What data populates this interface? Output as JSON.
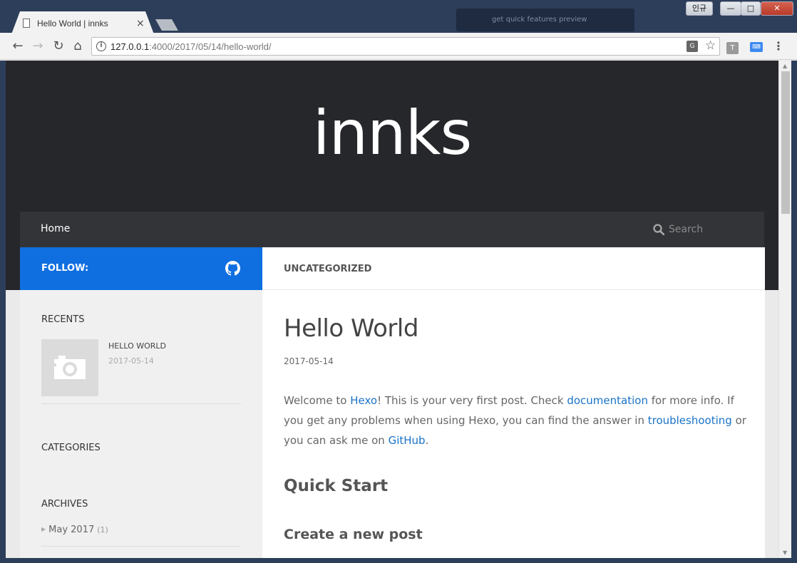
{
  "browser": {
    "tab_title": "Hello World | innks",
    "tab_close": "×",
    "url_host": "127.0.0.1",
    "url_rest": ":4000/2017/05/14/hello-world/",
    "user_button": "인규",
    "notification": "get quick features preview",
    "ext1_label": "T",
    "ext2_label": "⌨"
  },
  "site": {
    "title": "innks",
    "nav_home": "Home",
    "search_placeholder": "Search"
  },
  "sidebar": {
    "follow_label": "FOLLOW:",
    "recents_heading": "RECENTS",
    "recent_post": {
      "title": "HELLO WORLD",
      "date": "2017-05-14"
    },
    "categories_heading": "CATEGORIES",
    "archives_heading": "ARCHIVES",
    "archive_item": {
      "label": "May 2017",
      "count": "(1)"
    }
  },
  "post": {
    "category": "UNCATEGORIZED",
    "title": "Hello World",
    "date": "2017-05-14",
    "body": {
      "t1": "Welcome to ",
      "link_hexo": "Hexo",
      "t2": "! This is your very first post. Check ",
      "link_docs": "documentation",
      "t3": " for more info. If you get any problems when using Hexo, you can find the answer in ",
      "link_trouble": "troubleshooting",
      "t4": " or you can ask me on ",
      "link_github": "GitHub",
      "t5": "."
    },
    "h2": "Quick Start",
    "h3": "Create a new post"
  },
  "colors": {
    "header_bg": "#26272b",
    "navbar_bg": "#333438",
    "follow_bg": "#0f6fe0",
    "link": "#1a73c8"
  }
}
